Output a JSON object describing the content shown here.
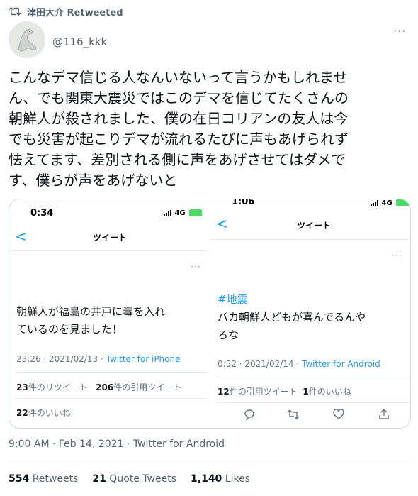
{
  "retweet": {
    "label": "津田大介 Retweeted"
  },
  "author": {
    "handle": "@116_kkk"
  },
  "more_label": "···",
  "tweet": {
    "lines": [
      "こんなデマ信じる人なんいないって言うかもしれませ",
      "ん、でも関東大震災ではこのデマを信じてたくさんの",
      "朝鮮人が殺されました、僕の在日コリアンの友人は今",
      "でも災害が起こりデマが流れるたびに声もあげられず",
      "怯えてます、差別される側に声をあげさせてはダメで",
      "す、僕らが声をあげないと"
    ],
    "timestamp": "9:00 AM · Feb 14, 2021 · Twitter for Android",
    "stats": {
      "retweets_count": "554",
      "retweets_label": "Retweets",
      "quotes_count": "21",
      "quotes_label": "Quote Tweets",
      "likes_count": "1,140",
      "likes_label": "Likes"
    }
  },
  "screenshot_a": {
    "status_time": "0:34",
    "status_net": "4G",
    "back": "<",
    "nav_title": "ツイート",
    "dots": "···",
    "text_lines": [
      "朝鮮人が福島の井戸に毒を入れ",
      "ているのを見ました！"
    ],
    "time": "23:26 · 2021/02/13 · ",
    "source": "Twitter for iPhone",
    "retweets_count": "23",
    "retweets_label": "件のリツイート",
    "quotes_count": "206",
    "quotes_label": "件の引用ツイート",
    "likes_count": "22",
    "likes_label": "件のいいね"
  },
  "screenshot_b": {
    "status_time": "1:06",
    "status_net": "4G",
    "back": "<",
    "nav_title": "ツイート",
    "dots": "···",
    "hashtag": "#地震",
    "text_lines": [
      "バカ朝鮮人どもが喜んでるんや",
      "ろな"
    ],
    "time": "0:52 · 2021/02/14 · ",
    "source": "Twitter for Android",
    "quotes_count": "12",
    "quotes_label": "件の引用ツイート",
    "likes_count": "1",
    "likes_label": "件のいいね"
  },
  "colors": {
    "accent": "#1d9bf0",
    "muted": "#536471",
    "text": "#0f1419"
  }
}
